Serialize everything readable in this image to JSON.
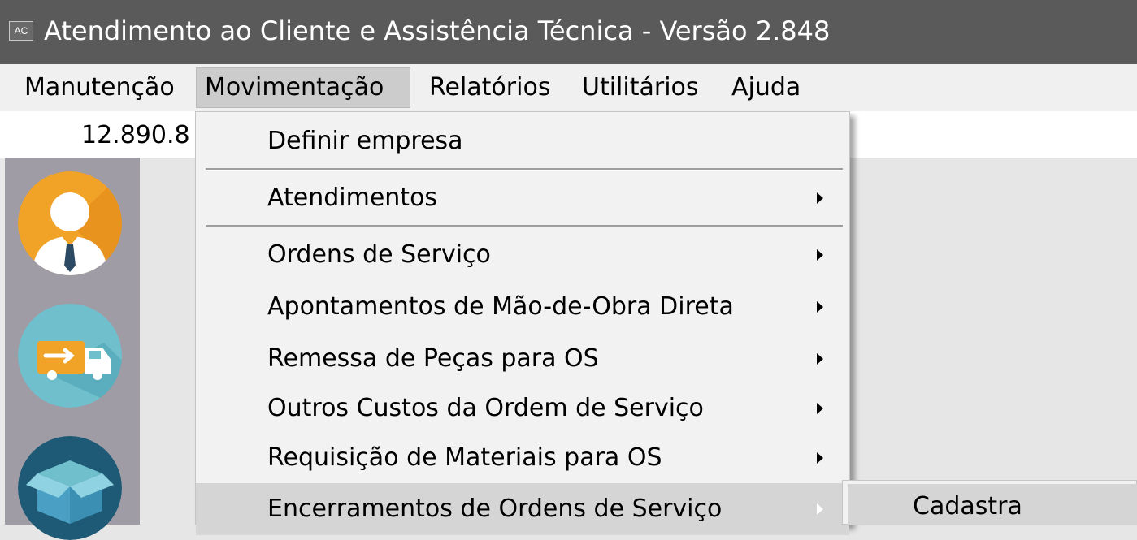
{
  "window": {
    "icon_text": "AC",
    "title": "Atendimento ao Cliente e Assistência Técnica - Versão 2.848"
  },
  "menubar": {
    "items": [
      {
        "label": "Manutenção"
      },
      {
        "label": "Movimentação",
        "active": true
      },
      {
        "label": "Relatórios"
      },
      {
        "label": "Utilitários"
      },
      {
        "label": "Ajuda"
      }
    ]
  },
  "status": {
    "value": "12.890.8"
  },
  "sidebar": {
    "buttons": [
      {
        "icon": "user-icon",
        "color": "#f0a326"
      },
      {
        "icon": "truck-icon",
        "color": "#6fbfcc"
      },
      {
        "icon": "box-icon",
        "color": "#1e5a75"
      }
    ]
  },
  "dropdown": {
    "items": [
      {
        "label": "Definir empresa",
        "submenu": false
      },
      {
        "label": "Atendimentos",
        "submenu": true
      },
      {
        "label": "Ordens de Serviço",
        "submenu": true
      },
      {
        "label": "Apontamentos de Mão-de-Obra Direta",
        "submenu": true
      },
      {
        "label": "Remessa de Peças para OS",
        "submenu": true
      },
      {
        "label": "Outros Custos da Ordem de Serviço",
        "submenu": true
      },
      {
        "label": "Requisição de Materiais para OS",
        "submenu": true
      },
      {
        "label": "Encerramentos de Ordens de Serviço",
        "submenu": true,
        "highlighted": true
      }
    ]
  },
  "submenu": {
    "items": [
      {
        "label": "Cadastra",
        "highlighted": true
      }
    ]
  }
}
